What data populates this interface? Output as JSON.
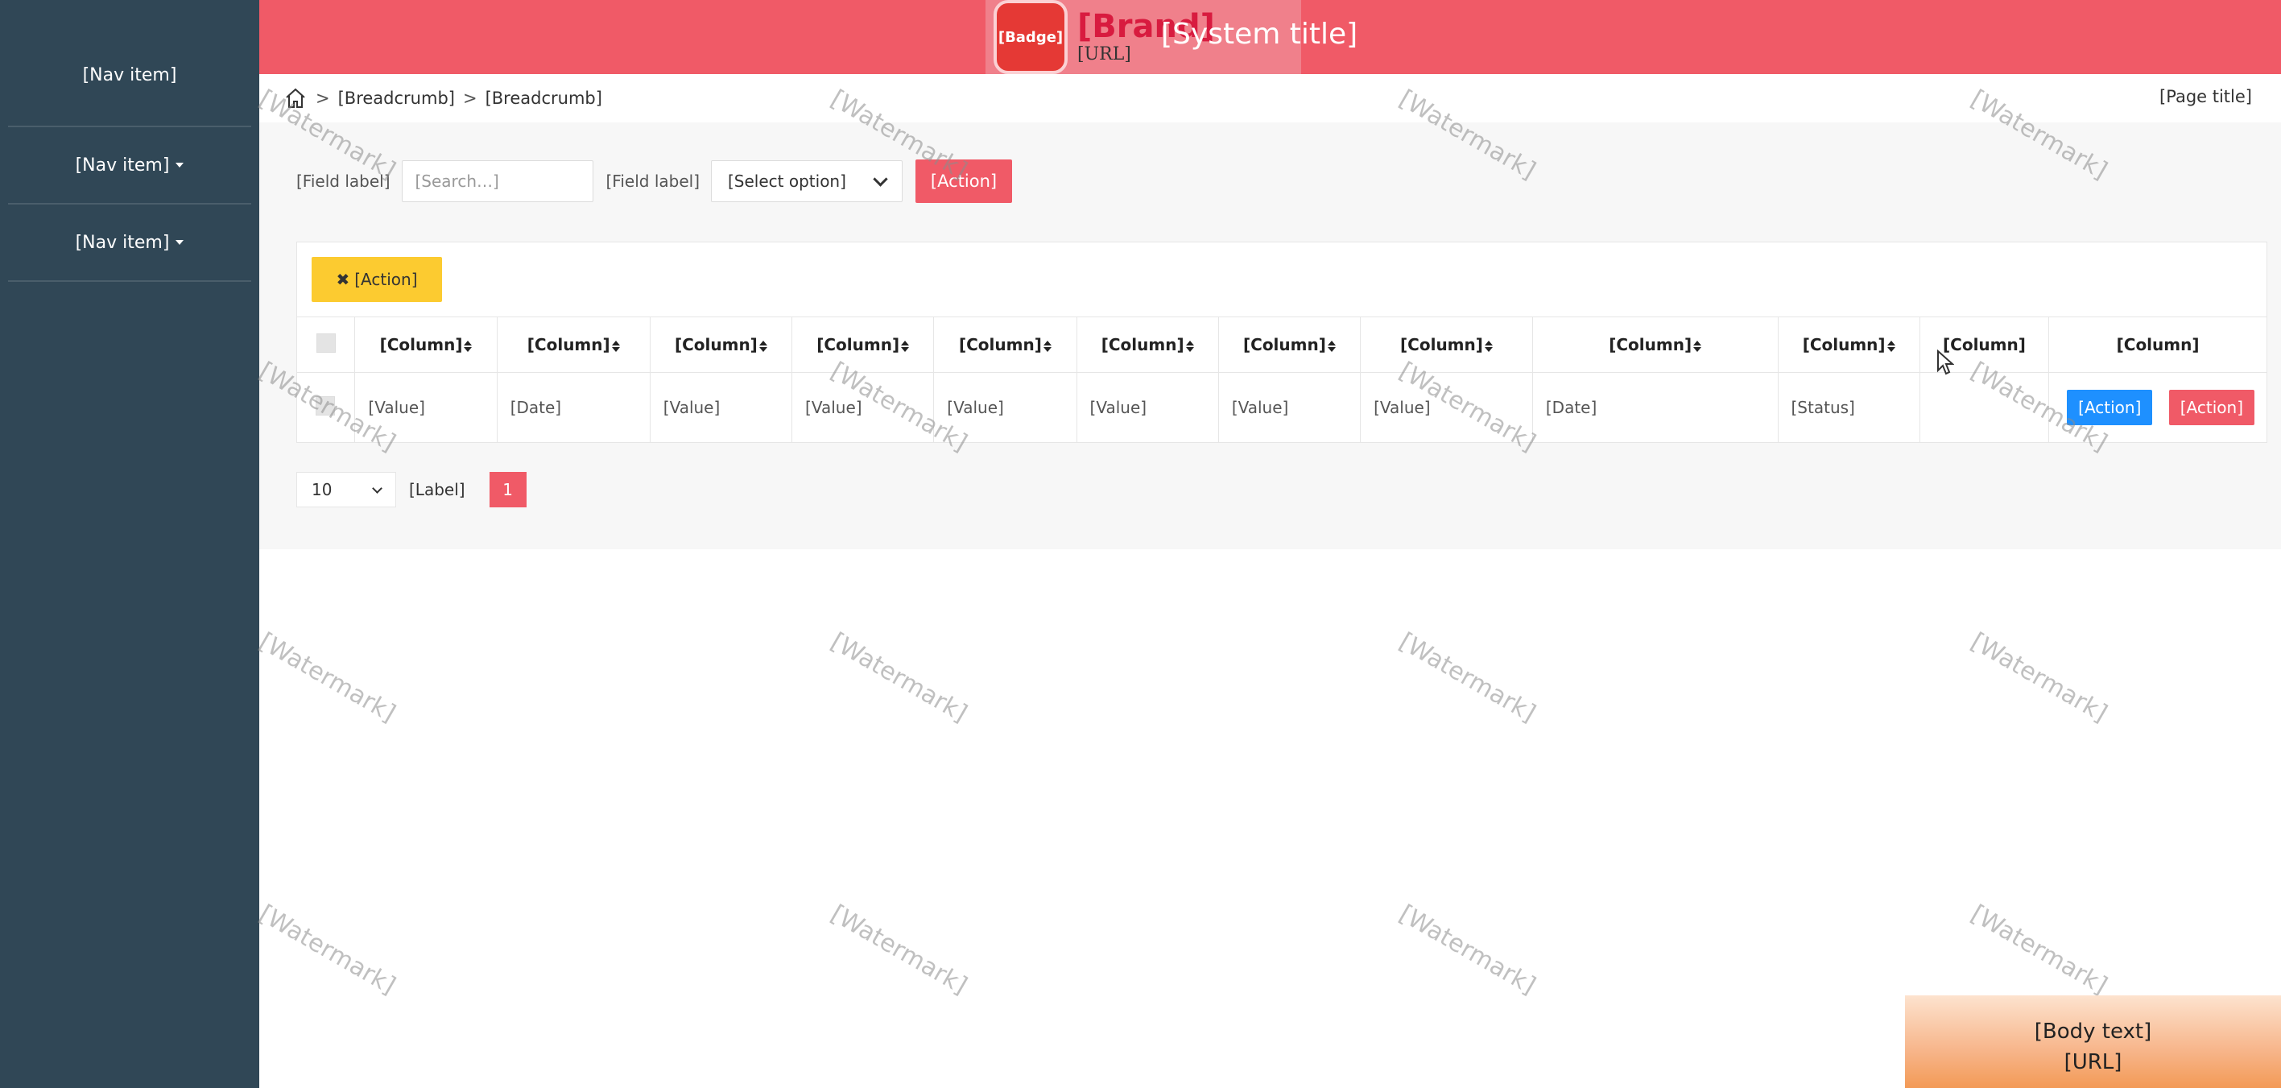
{
  "sidebar": {
    "items": [
      {
        "label": "[Nav item]",
        "has_dropdown": false
      },
      {
        "label": "[Nav item]",
        "has_dropdown": true
      },
      {
        "label": "[Nav item]",
        "has_dropdown": true
      }
    ]
  },
  "header": {
    "logo_badge": "[Badge]",
    "logo_main": "[Brand]",
    "logo_url": "[URL]",
    "system_title": "[System title]",
    "fullscreen_icon": "expand-icon",
    "user_icon": "user-icon"
  },
  "breadcrumb": {
    "home_icon": "home-icon",
    "separator": ">",
    "items": [
      "[Breadcrumb]",
      "[Breadcrumb]"
    ],
    "right_title": "[Page title]"
  },
  "search": {
    "name_label": "[Field label]",
    "name_placeholder": "[Search…]",
    "status_label": "[Field label]",
    "status_value": "[Select option]",
    "query_label": "[Action]"
  },
  "toolbar": {
    "batch_delete_icon": "✖",
    "batch_delete_label": "[Action]"
  },
  "table": {
    "columns": [
      "[Column]",
      "[Column]",
      "[Column]",
      "[Column]",
      "[Column]",
      "[Column]",
      "[Column]",
      "[Column]",
      "[Column]",
      "[Column]",
      "[Column]",
      "[Column]"
    ],
    "rows": [
      {
        "cells": [
          "[Value]",
          "[Date]",
          "[Value]",
          "[Value]",
          "[Value]",
          "[Value]",
          "[Value]",
          "[Value]",
          "[Date]",
          "[Status]",
          ""
        ],
        "view_label": "[Action]",
        "delete_label": "[Action]"
      }
    ]
  },
  "pager": {
    "page_size": "10",
    "per_page_label": "[Label]",
    "current_page": "1"
  },
  "watermark_text": "[Watermark]",
  "promo": {
    "line1": "[Body text]",
    "line2": "[URL]"
  },
  "colors": {
    "sidebar_bg": "#304756",
    "header_bg": "#f05a67",
    "accent_red": "#f05a67",
    "view_blue": "#1e90ff",
    "batch_yellow": "#fccb30"
  }
}
